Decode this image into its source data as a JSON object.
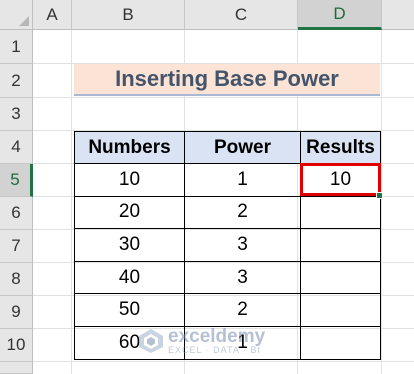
{
  "columns": [
    "A",
    "B",
    "C",
    "D"
  ],
  "rows": [
    "1",
    "2",
    "3",
    "4",
    "5",
    "6",
    "7",
    "8",
    "9",
    "10"
  ],
  "selected": {
    "column": "D",
    "row": "5"
  },
  "title": "Inserting Base Power",
  "table": {
    "headers": [
      "Numbers",
      "Power",
      "Results"
    ],
    "rows": [
      [
        "10",
        "1",
        "10"
      ],
      [
        "20",
        "2",
        ""
      ],
      [
        "30",
        "3",
        ""
      ],
      [
        "40",
        "3",
        ""
      ],
      [
        "50",
        "2",
        ""
      ],
      [
        "60",
        "1",
        ""
      ]
    ]
  },
  "active_cell_value": "10",
  "watermark": {
    "name": "exceldemy",
    "tagline": "EXCEL · DATA · BI"
  },
  "colors": {
    "title_fill": "#fbe3d6",
    "header_fill": "#dae3f3",
    "highlight_border": "#e00000",
    "excel_green": "#217346"
  }
}
